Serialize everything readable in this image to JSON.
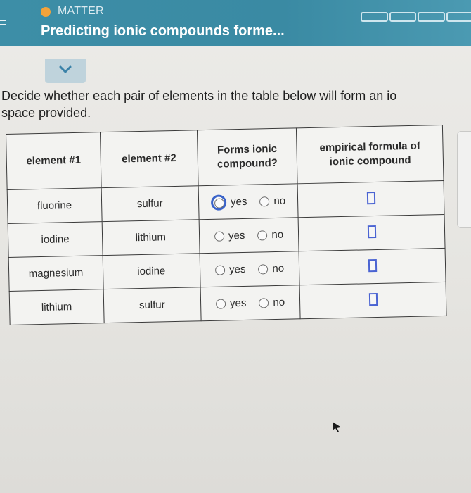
{
  "header": {
    "topic": "MATTER",
    "title": "Predicting ionic compounds forme...",
    "progress_segments": 4
  },
  "instructions": {
    "line1": "Decide whether each pair of elements in the table below will form an io",
    "line2": "space provided."
  },
  "table": {
    "headers": {
      "element1": "element #1",
      "element2": "element #2",
      "forms_ionic_line1": "Forms ionic",
      "forms_ionic_line2": "compound?",
      "formula_line1": "empirical formula of",
      "formula_line2": "ionic compound"
    },
    "options": {
      "yes": "yes",
      "no": "no"
    },
    "rows": [
      {
        "element1": "fluorine",
        "element2": "sulfur",
        "formula": ""
      },
      {
        "element1": "iodine",
        "element2": "lithium",
        "formula": ""
      },
      {
        "element1": "magnesium",
        "element2": "iodine",
        "formula": ""
      },
      {
        "element1": "lithium",
        "element2": "sulfur",
        "formula": ""
      }
    ]
  },
  "colors": {
    "header_bg": "#3d8ea7",
    "topic_dot": "#f4a33a",
    "focus_ring": "#3a63c9",
    "input_border": "#4a63d2"
  },
  "icons": {
    "collapse": "chevron-down-icon",
    "topic": "topic-dot-icon",
    "menu": "menu-icon",
    "pointer": "mouse-cursor-icon"
  }
}
